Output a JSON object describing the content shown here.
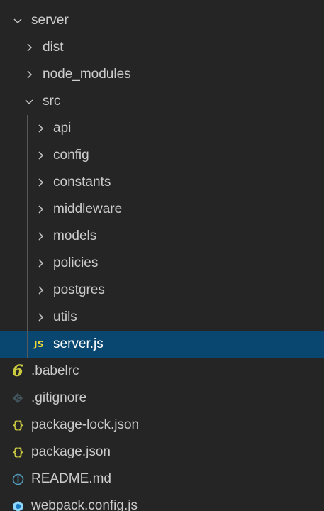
{
  "explorer": {
    "root": {
      "label": "server",
      "expanded": true
    },
    "dist": {
      "label": "dist",
      "expanded": false
    },
    "node_modules": {
      "label": "node_modules",
      "expanded": false
    },
    "src": {
      "label": "src",
      "expanded": true,
      "folders": [
        "api",
        "config",
        "constants",
        "middleware",
        "models",
        "policies",
        "postgres",
        "utils"
      ],
      "server_js": {
        "label": "server.js",
        "icon": "js-file-icon",
        "badge": "JS",
        "selected": true
      }
    },
    "files": [
      {
        "label": ".babelrc",
        "icon": "babel-file-icon",
        "badge": "6"
      },
      {
        "label": ".gitignore",
        "icon": "git-file-icon"
      },
      {
        "label": "package-lock.json",
        "icon": "json-file-icon",
        "badge": "{}"
      },
      {
        "label": "package.json",
        "icon": "json-file-icon",
        "badge": "{}"
      },
      {
        "label": "README.md",
        "icon": "info-icon"
      },
      {
        "label": "webpack.config.js",
        "icon": "webpack-icon"
      }
    ]
  },
  "colors": {
    "background": "#252526",
    "selected_row": "#094771",
    "text": "#cccccc",
    "selected_text": "#ffffff",
    "js_badge": "#f1dd35",
    "json_badge": "#cbcb41",
    "info": "#519aba",
    "git": "#41535b",
    "webpack": "#8ed6fb"
  }
}
